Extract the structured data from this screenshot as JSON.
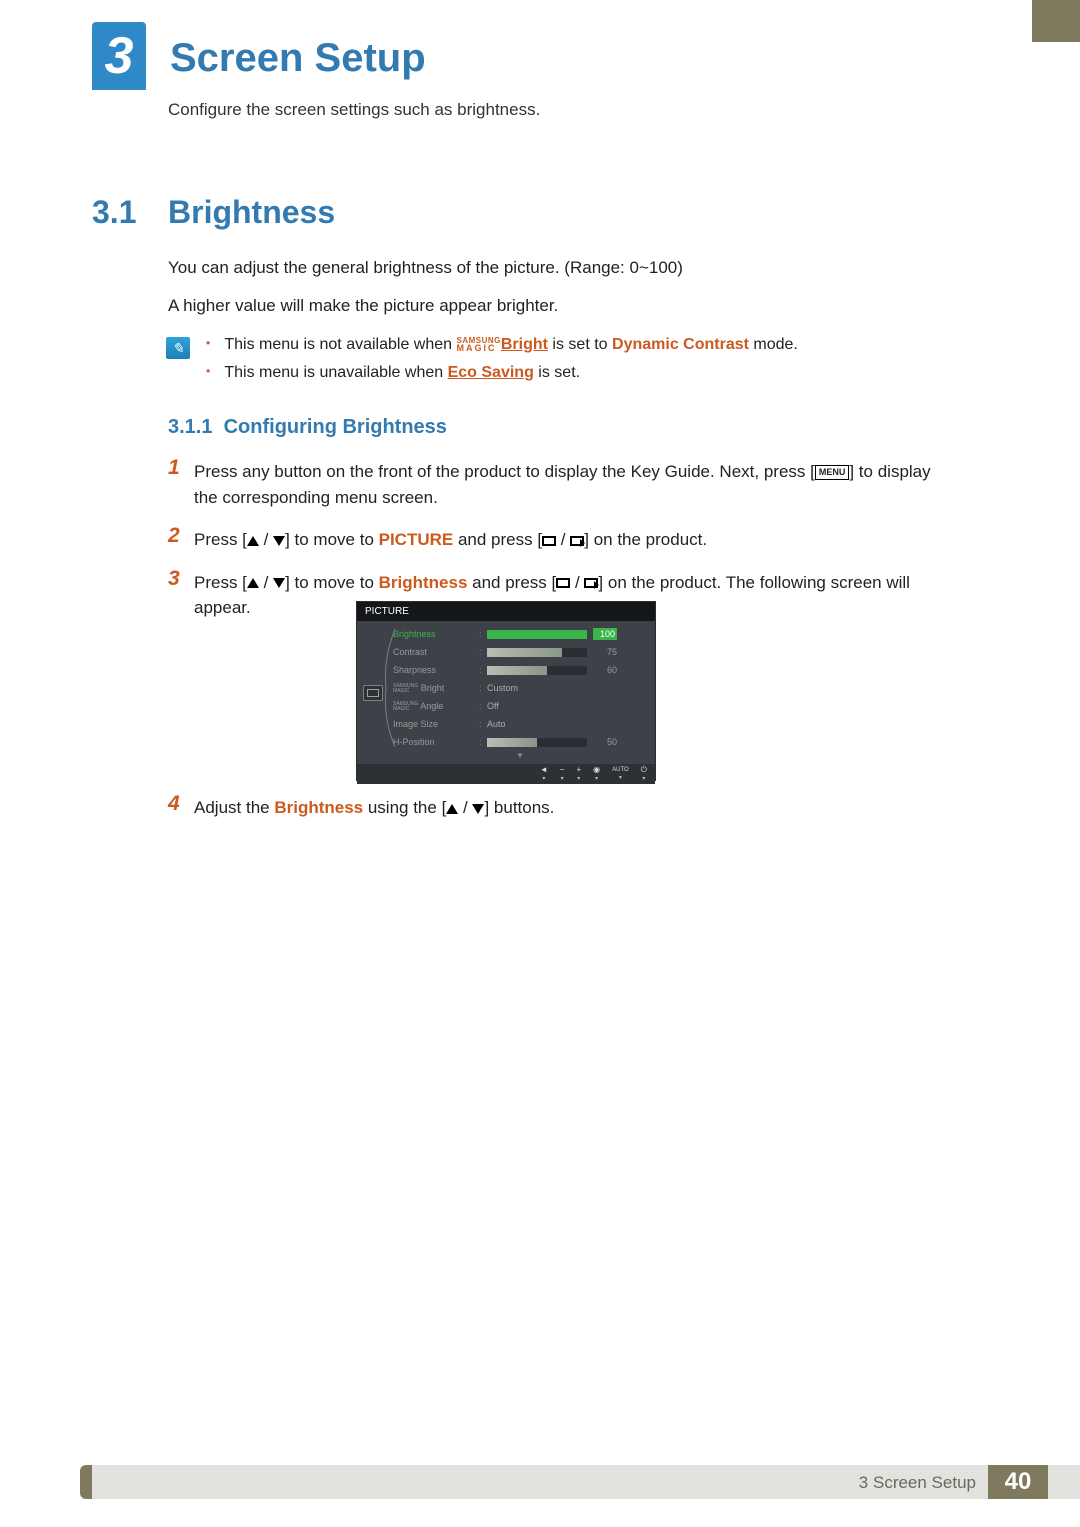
{
  "chapter": {
    "number": "3",
    "title": "Screen Setup",
    "description": "Configure the screen settings such as brightness."
  },
  "section": {
    "number": "3.1",
    "title": "Brightness",
    "para1": "You can adjust the general brightness of the picture. (Range: 0~100)",
    "para2": "A higher value will make the picture appear brighter.",
    "notes": {
      "item1_a": "This menu is not available when ",
      "samsung_top": "SAMSUNG",
      "samsung_bot": "MAGIC",
      "item1_b": "Bright",
      "item1_c": " is set to ",
      "item1_d": "Dynamic Contrast",
      "item1_e": " mode.",
      "item2_a": "This menu is unavailable when ",
      "item2_b": "Eco Saving",
      "item2_c": " is set."
    }
  },
  "subsection": {
    "number": "3.1.1",
    "title": "Configuring Brightness"
  },
  "steps": {
    "s1": {
      "num": "1",
      "text_a": "Press any button on the front of the product to display the Key Guide. Next, press [",
      "menu": "MENU",
      "text_b": "] to display the corresponding menu screen."
    },
    "s2": {
      "num": "2",
      "text_a": "Press [",
      "text_b": "] to move to ",
      "picture": "PICTURE",
      "text_c": " and press [",
      "text_d": "] on the product."
    },
    "s3": {
      "num": "3",
      "text_a": "Press [",
      "text_b": "] to move to ",
      "brightness": "Brightness",
      "text_c": " and press [",
      "text_d": "] on the product. The following screen will appear."
    },
    "s4": {
      "num": "4",
      "text_a": "Adjust the ",
      "brightness": "Brightness",
      "text_b": " using the [",
      "text_c": "] buttons."
    }
  },
  "osd": {
    "title": "PICTURE",
    "rows": {
      "brightness": {
        "label": "Brightness",
        "value": "100",
        "fill": 100
      },
      "contrast": {
        "label": "Contrast",
        "value": "75",
        "fill": 75
      },
      "sharpness": {
        "label": "Sharpness",
        "value": "60",
        "fill": 60
      },
      "magic_bright": {
        "label": "Bright",
        "value": "Custom"
      },
      "magic_angle": {
        "label": "Angle",
        "value": "Off"
      },
      "image_size": {
        "label": "Image Size",
        "value": "Auto"
      },
      "h_position": {
        "label": "H-Position",
        "value": "50",
        "fill": 50
      }
    },
    "footer": {
      "auto": "AUTO"
    }
  },
  "footer": {
    "chapter_text": "3 Screen Setup",
    "page": "40"
  }
}
